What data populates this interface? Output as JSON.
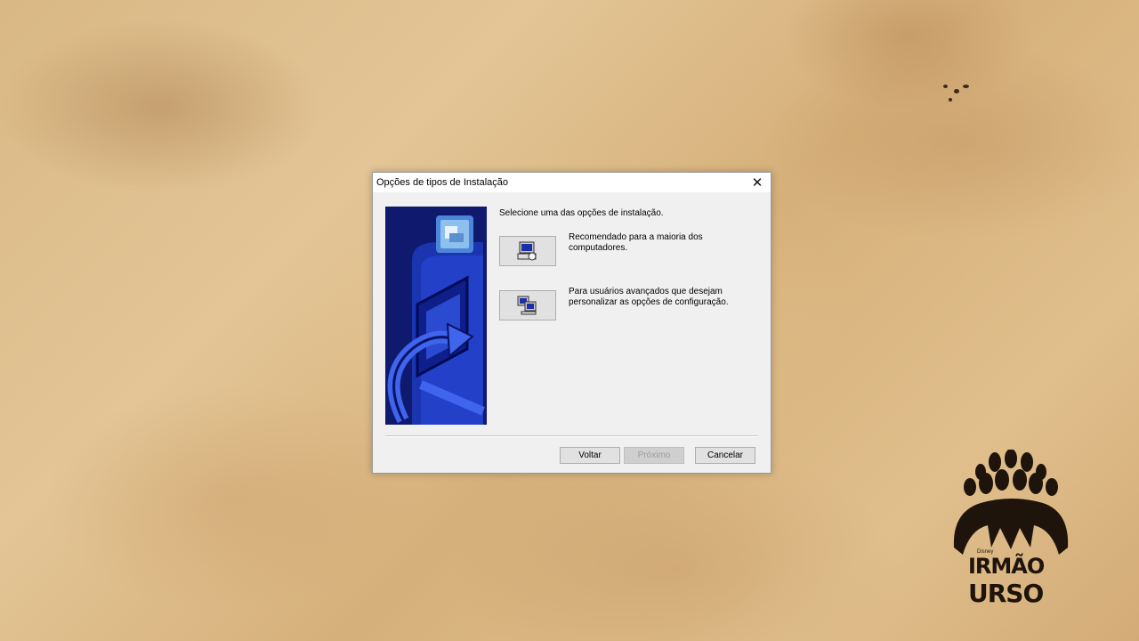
{
  "dialog": {
    "title": "Opções de tipos de Instalação",
    "close_icon": "close-icon",
    "prompt": "Selecione uma das opções de instalação.",
    "options": [
      {
        "icon": "computer-install-icon",
        "description": "Recomendado para a maioria dos computadores."
      },
      {
        "icon": "custom-install-icon",
        "description": "Para usuários avançados que desejam personalizar as opções de configuração."
      }
    ],
    "buttons": {
      "back": "Voltar",
      "next": "Próximo",
      "cancel": "Cancelar"
    },
    "next_disabled": true
  },
  "watermark": {
    "small_text": "Disney",
    "line1": "IRMÃO",
    "line2": "URSO"
  },
  "colors": {
    "sidebar_blue": "#0f1a6e",
    "accent_blue": "#2a4ad0",
    "dialog_bg": "#f0f0f0"
  }
}
